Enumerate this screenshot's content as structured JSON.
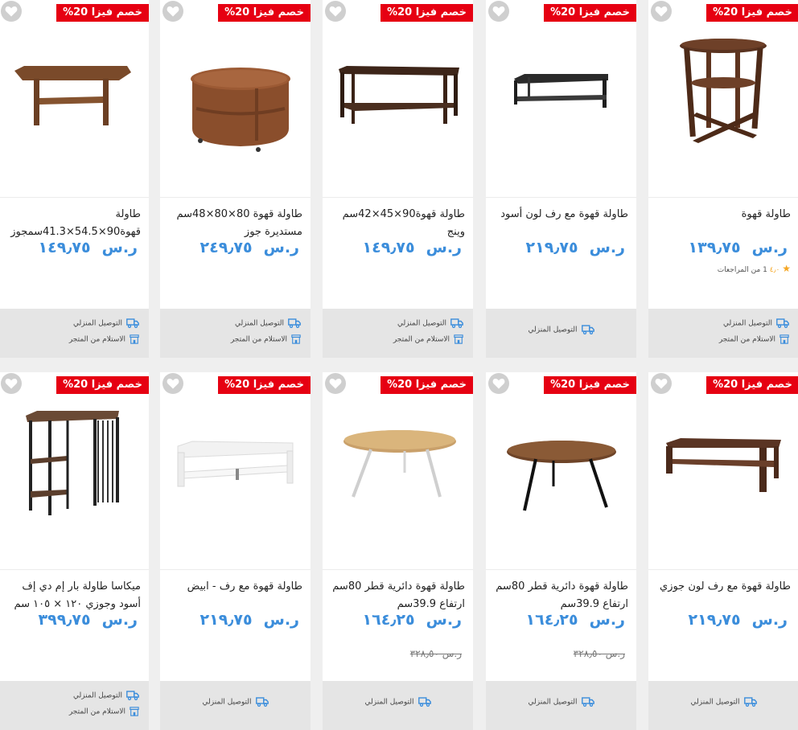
{
  "badge_text": "خصم فيزا 20%",
  "colors": {
    "accent_price": "#3b8ddb",
    "badge": "#e60012",
    "delivery_icon": "#3b8ddb"
  },
  "icons": {
    "wishlist": "heart-icon",
    "truck": "truck-icon",
    "store": "store-icon",
    "rating": "star-icon"
  },
  "row1": [
    {
      "title": "طاولة قهوة",
      "currency": "ر.س",
      "price": "١٣٩٫٧٥",
      "rating": {
        "value": "٤٫٠",
        "reviews": "1 من المراجعات"
      },
      "delivery": [
        "التوصيل المنزلي",
        "الاستلام من المتجر"
      ]
    },
    {
      "title": "طاولة قهوة مع رف لون أسود",
      "currency": "ر.س",
      "price": "٢١٩٫٧٥",
      "delivery": [
        "التوصيل المنزلي"
      ]
    },
    {
      "title": "طاولة قهوة90×45×42سم وينج",
      "currency": "ر.س",
      "price": "١٤٩٫٧٥",
      "delivery": [
        "التوصيل المنزلي",
        "الاستلام من المتجر"
      ]
    },
    {
      "title": "طاولة قهوة 80×80×48سم مستديرة جوز",
      "currency": "ر.س",
      "price": "٢٤٩٫٧٥",
      "delivery": [
        "التوصيل المنزلي",
        "الاستلام من المتجر"
      ]
    },
    {
      "title": "طاولة قهوة90×54.5×41.3سمجوز",
      "currency": "ر.س",
      "price": "١٤٩٫٧٥",
      "delivery": [
        "التوصيل المنزلي",
        "الاستلام من المتجر"
      ]
    }
  ],
  "row2": [
    {
      "title": "طاولة قهوة مع رف لون جوزي",
      "currency": "ر.س",
      "price": "٢١٩٫٧٥",
      "delivery": [
        "التوصيل المنزلي"
      ]
    },
    {
      "title": "طاولة قهوة دائرية قطر 80سم ارتفاع 39.9سم",
      "currency": "ر.س",
      "price": "١٦٤٫٢٥",
      "old_price": "ر.س ٣٢٨٫٥٠",
      "delivery": [
        "التوصيل المنزلي"
      ]
    },
    {
      "title": "طاولة قهوة دائرية قطر 80سم ارتفاع 39.9سم",
      "currency": "ر.س",
      "price": "١٦٤٫٢٥",
      "old_price": "ر.س ٣٢٨٫٥٠",
      "delivery": [
        "التوصيل المنزلي"
      ]
    },
    {
      "title": "طاولة قهوة مع رف - ابيض",
      "currency": "ر.س",
      "price": "٢١٩٫٧٥",
      "delivery": [
        "التوصيل المنزلي"
      ]
    },
    {
      "title": "ميكاسا طاولة بار إم دي إف أسود وجوزي ١٢٠ × ١٠٥ سم",
      "currency": "ر.س",
      "price": "٣٩٩٫٧٥",
      "delivery": [
        "التوصيل المنزلي",
        "الاستلام من المتجر"
      ]
    }
  ]
}
